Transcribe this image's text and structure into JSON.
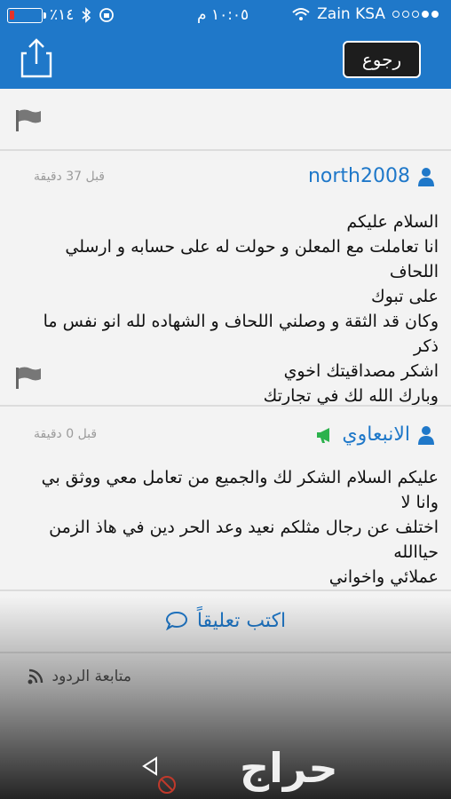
{
  "status_bar": {
    "battery_text": "٪١٤",
    "battery_level": 0.14,
    "time": "١٠:٠٥ م",
    "carrier": "Zain KSA"
  },
  "nav": {
    "back_label": "رجوع",
    "share_icon": "share-icon"
  },
  "comments": [
    {
      "user": "north2008",
      "time_ago": "قبل 37 دقيقة",
      "lines": [
        "السلام عليكم",
        "انا تعاملت مع المعلن و حولت له على حسابه و ارسلي اللحاف",
        "على تبوك",
        "وكان قد الثقة و وصلني اللحاف و الشهاده لله انو نفس ما ذكر",
        "اشكر مصداقيتك اخوي",
        "وبارك الله لك في تجارتك"
      ]
    },
    {
      "user": "الانبعاوي",
      "time_ago": "قبل 0 دقيقة",
      "lines": [
        "عليكم السلام الشكر لك والجميع من تعامل معي ووثق بي وانا لا",
        "اختلف عن رجال مثلكم نعيد وعد الحر دين في هاذ الزمن حياالله",
        "عملائي واخواني"
      ]
    }
  ],
  "write_comment_label": "اكتب تعليقاً",
  "follow_label": "متابعة الردود",
  "logo_text": "حراج",
  "colors": {
    "brand_blue": "#1f78c9",
    "battery_red": "#e5332a",
    "advertiser_green": "#2bb24c"
  }
}
